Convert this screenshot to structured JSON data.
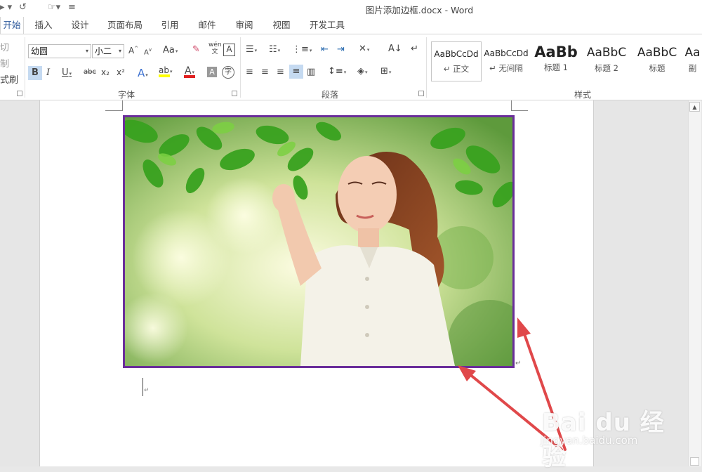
{
  "window": {
    "title": "图片添加边框.docx - Word"
  },
  "tabs": [
    {
      "label": "开始",
      "active": true
    },
    {
      "label": "插入"
    },
    {
      "label": "设计"
    },
    {
      "label": "页面布局"
    },
    {
      "label": "引用"
    },
    {
      "label": "邮件"
    },
    {
      "label": "审阅"
    },
    {
      "label": "视图"
    },
    {
      "label": "开发工具"
    }
  ],
  "clipboard": {
    "cut": "切",
    "copy": "制",
    "format_painter": "式刷"
  },
  "font": {
    "group_label": "字体",
    "name": "幼圆",
    "size": "小二",
    "bold": "B",
    "italic": "I",
    "underline": "U",
    "strike": "abc",
    "sub": "x₂",
    "sup": "x²",
    "change_case": "Aa",
    "grow": "A",
    "shrink": "A",
    "phonetic": "wén 文"
  },
  "paragraph": {
    "group_label": "段落"
  },
  "styles": {
    "group_label": "样式",
    "items": [
      {
        "sample": "AaBbCcDd",
        "name": "↵ 正文"
      },
      {
        "sample": "AaBbCcDd",
        "name": "↵ 无间隔"
      },
      {
        "sample": "AaBb",
        "name": "标题 1"
      },
      {
        "sample": "AaBbC",
        "name": "标题 2"
      },
      {
        "sample": "AaBbC",
        "name": "标题"
      },
      {
        "sample": "Aa",
        "name": "副"
      }
    ]
  },
  "watermark": {
    "brand": "Bai du 经验",
    "url": "jingyan.baidu.com"
  },
  "colors": {
    "border": "#6a2e9a",
    "arrow": "#e0484a",
    "accent": "#2b579a"
  }
}
